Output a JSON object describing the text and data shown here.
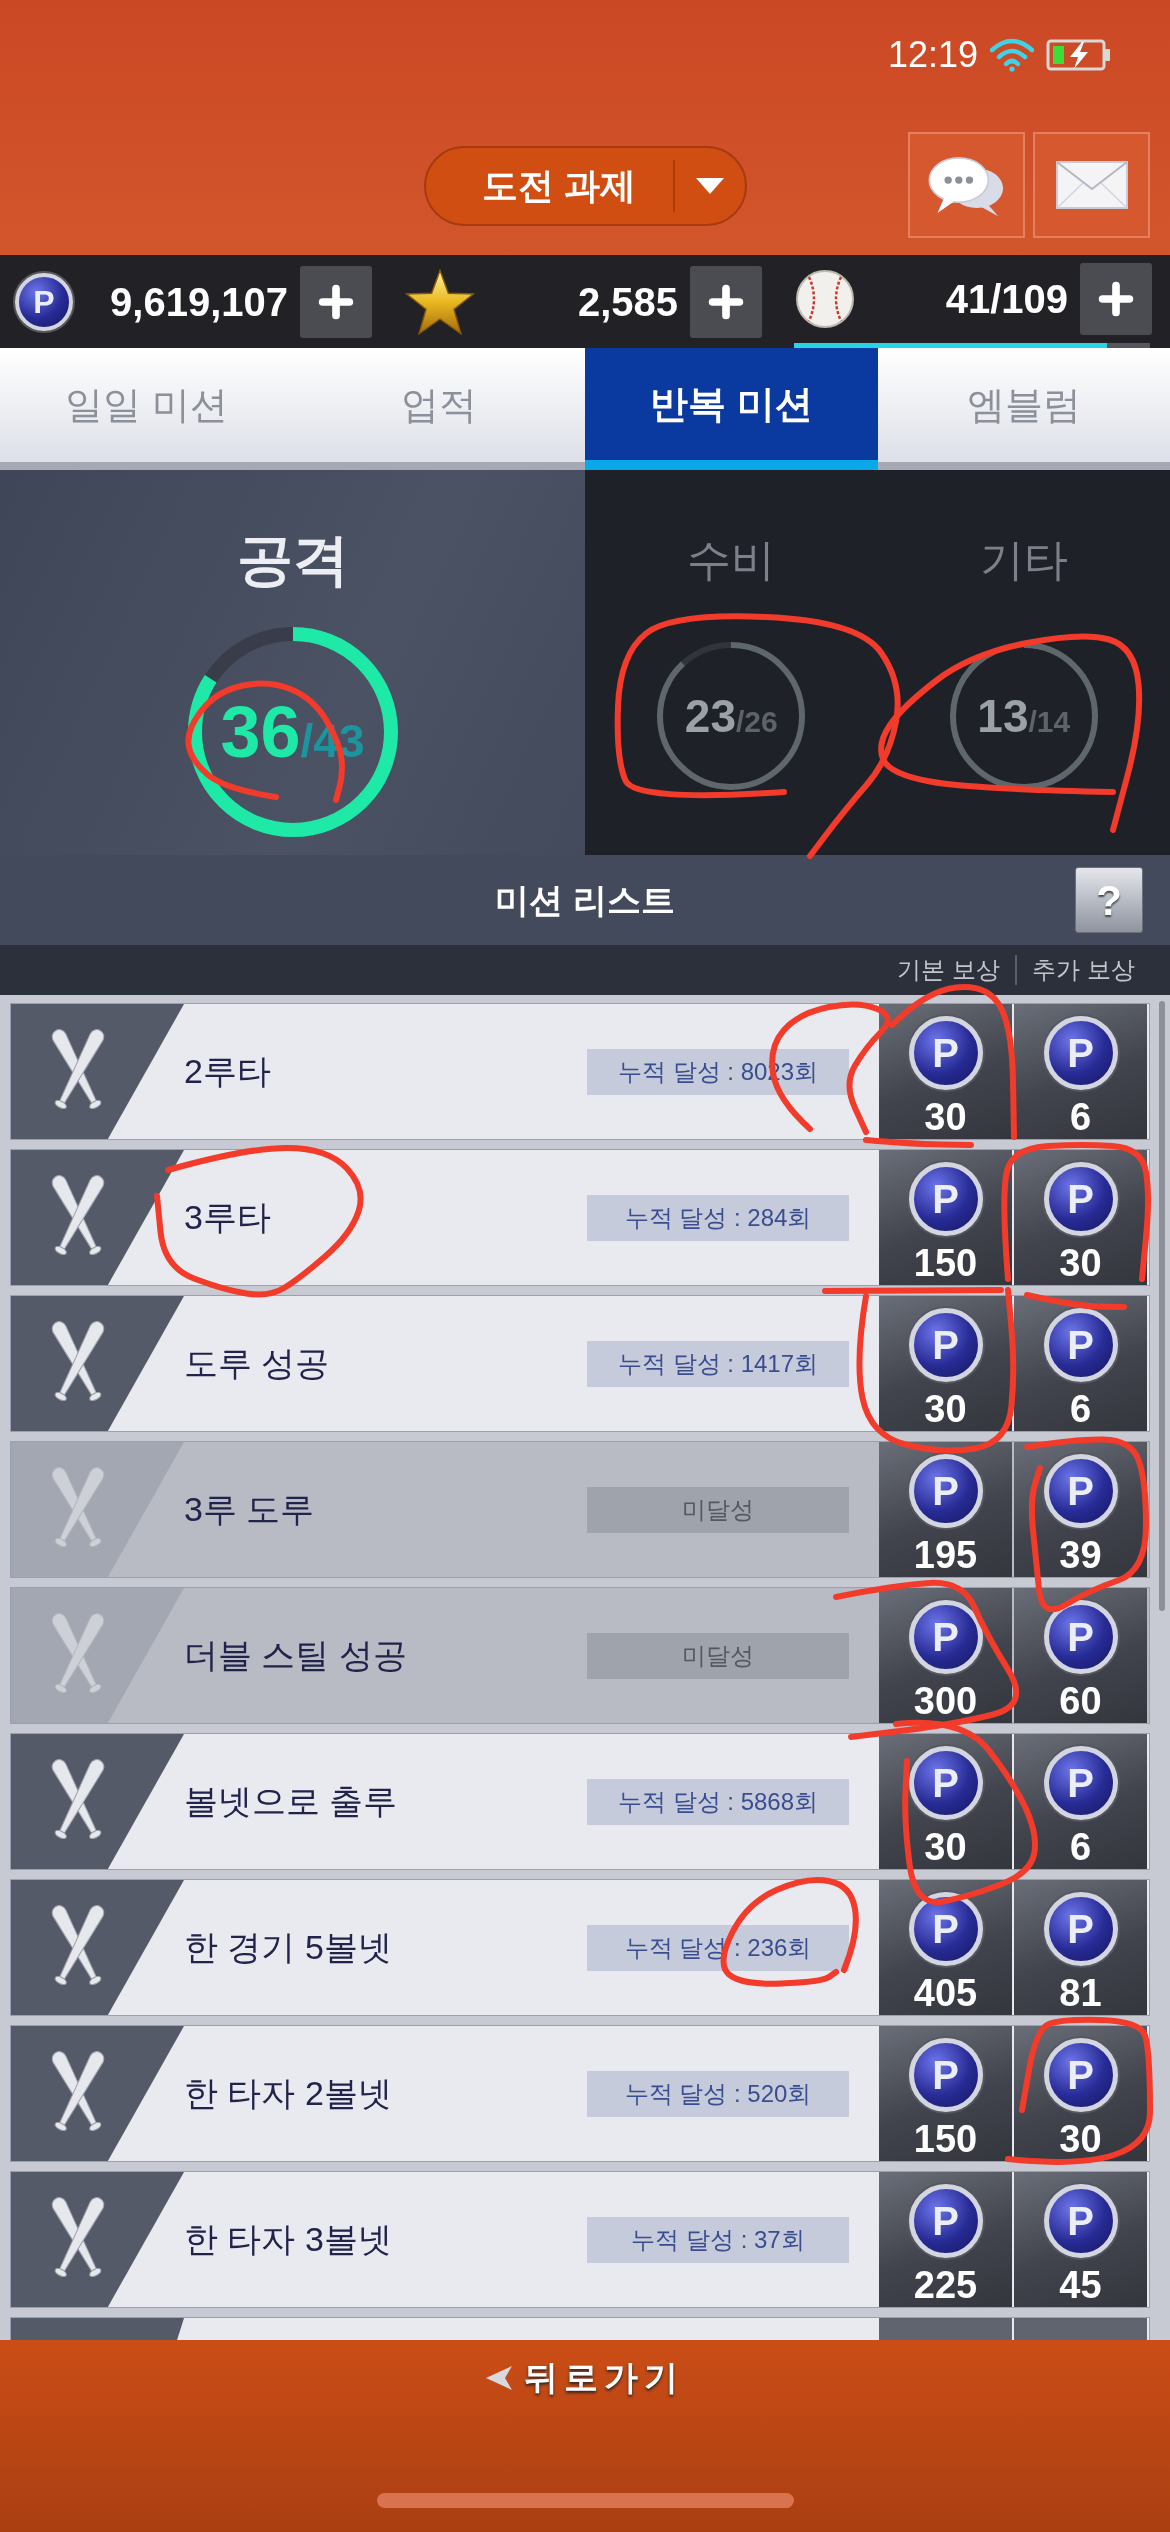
{
  "status_bar": {
    "time": "12:19"
  },
  "header": {
    "dropdown": {
      "label": "도전 과제"
    }
  },
  "currencies": [
    {
      "kind": "points",
      "coin": "P",
      "amount": "9,619,107"
    },
    {
      "kind": "star",
      "amount": "2,585"
    },
    {
      "kind": "ball",
      "amount": "41/109",
      "level": 0.88
    }
  ],
  "tabs": [
    {
      "label": "일일 미션",
      "selected": false
    },
    {
      "label": "업적",
      "selected": false
    },
    {
      "label": "반복 미션",
      "selected": true
    },
    {
      "label": "엠블럼",
      "selected": false
    }
  ],
  "categories": [
    {
      "label": "공격",
      "count": "36",
      "total": "/43",
      "level": 0.84,
      "selected": true
    },
    {
      "label": "수비",
      "count": "23",
      "total": "/26",
      "level": 0.88,
      "selected": false
    },
    {
      "label": "기타",
      "count": "13",
      "total": "/14",
      "level": 0.93,
      "selected": false
    }
  ],
  "mission_list": {
    "title": "미션 리스트",
    "help": "?",
    "columns": [
      "기본 보상",
      "추가 보상"
    ],
    "rows": [
      {
        "title": "2루타",
        "achieved": true,
        "progress": "누적 달성 : 8023회",
        "rewards": [
          {
            "coin": "P",
            "amount": "30"
          },
          {
            "coin": "P",
            "amount": "6"
          }
        ]
      },
      {
        "title": "3루타",
        "achieved": true,
        "progress": "누적 달성 : 284회",
        "rewards": [
          {
            "coin": "P",
            "amount": "150"
          },
          {
            "coin": "P",
            "amount": "30"
          }
        ]
      },
      {
        "title": "도루 성공",
        "achieved": true,
        "progress": "누적 달성 : 1417회",
        "rewards": [
          {
            "coin": "P",
            "amount": "30"
          },
          {
            "coin": "P",
            "amount": "6"
          }
        ]
      },
      {
        "title": "3루 도루",
        "achieved": false,
        "progress": "미달성",
        "rewards": [
          {
            "coin": "P",
            "amount": "195"
          },
          {
            "coin": "P",
            "amount": "39"
          }
        ]
      },
      {
        "title": "더블 스틸 성공",
        "achieved": false,
        "progress": "미달성",
        "rewards": [
          {
            "coin": "P",
            "amount": "300"
          },
          {
            "coin": "P",
            "amount": "60"
          }
        ]
      },
      {
        "title": "볼넷으로 출루",
        "achieved": true,
        "progress": "누적 달성 : 5868회",
        "rewards": [
          {
            "coin": "P",
            "amount": "30"
          },
          {
            "coin": "P",
            "amount": "6"
          }
        ]
      },
      {
        "title": "한 경기 5볼넷",
        "achieved": true,
        "progress": "누적 달성 : 236회",
        "rewards": [
          {
            "coin": "P",
            "amount": "405"
          },
          {
            "coin": "P",
            "amount": "81"
          }
        ]
      },
      {
        "title": "한 타자 2볼넷",
        "achieved": true,
        "progress": "누적 달성 : 520회",
        "rewards": [
          {
            "coin": "P",
            "amount": "150"
          },
          {
            "coin": "P",
            "amount": "30"
          }
        ]
      },
      {
        "title": "한 타자 3볼넷",
        "achieved": true,
        "progress": "누적 달성 : 37회",
        "rewards": [
          {
            "coin": "P",
            "amount": "225"
          },
          {
            "coin": "P",
            "amount": "45"
          }
        ]
      }
    ]
  },
  "back_button": {
    "label": "뒤로가기"
  }
}
